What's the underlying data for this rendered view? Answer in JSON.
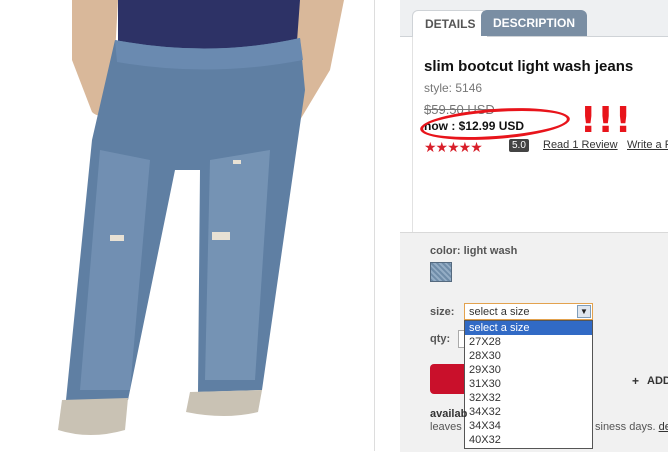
{
  "tabs": {
    "details": "DETAILS",
    "description": "DESCRIPTION"
  },
  "product": {
    "title": "slim bootcut light wash jeans",
    "style": "style: 5146",
    "old_price": "$59.50 USD",
    "now_price": "now : $12.99 USD",
    "annotation": "!!!",
    "stars": "★★★★★",
    "rating": "5.0",
    "read_review": "Read 1 Review",
    "write_review": "Write a R"
  },
  "options": {
    "color_label": "color: light wash",
    "size_label": "size:",
    "qty_label": "qty:",
    "size_selected": "select a size",
    "size_options": [
      "select a size",
      "27X28",
      "28X30",
      "29X30",
      "31X30",
      "32X32",
      "34X32",
      "34X34",
      "40X32"
    ],
    "add_text": "ADD",
    "avail": "availab",
    "leaves": "leaves",
    "business": "siness days.",
    "details_link": "det"
  },
  "colors": {
    "accent_red": "#e8141b",
    "tab_blue": "#7a8ea3",
    "cart_red": "#c9102b"
  }
}
